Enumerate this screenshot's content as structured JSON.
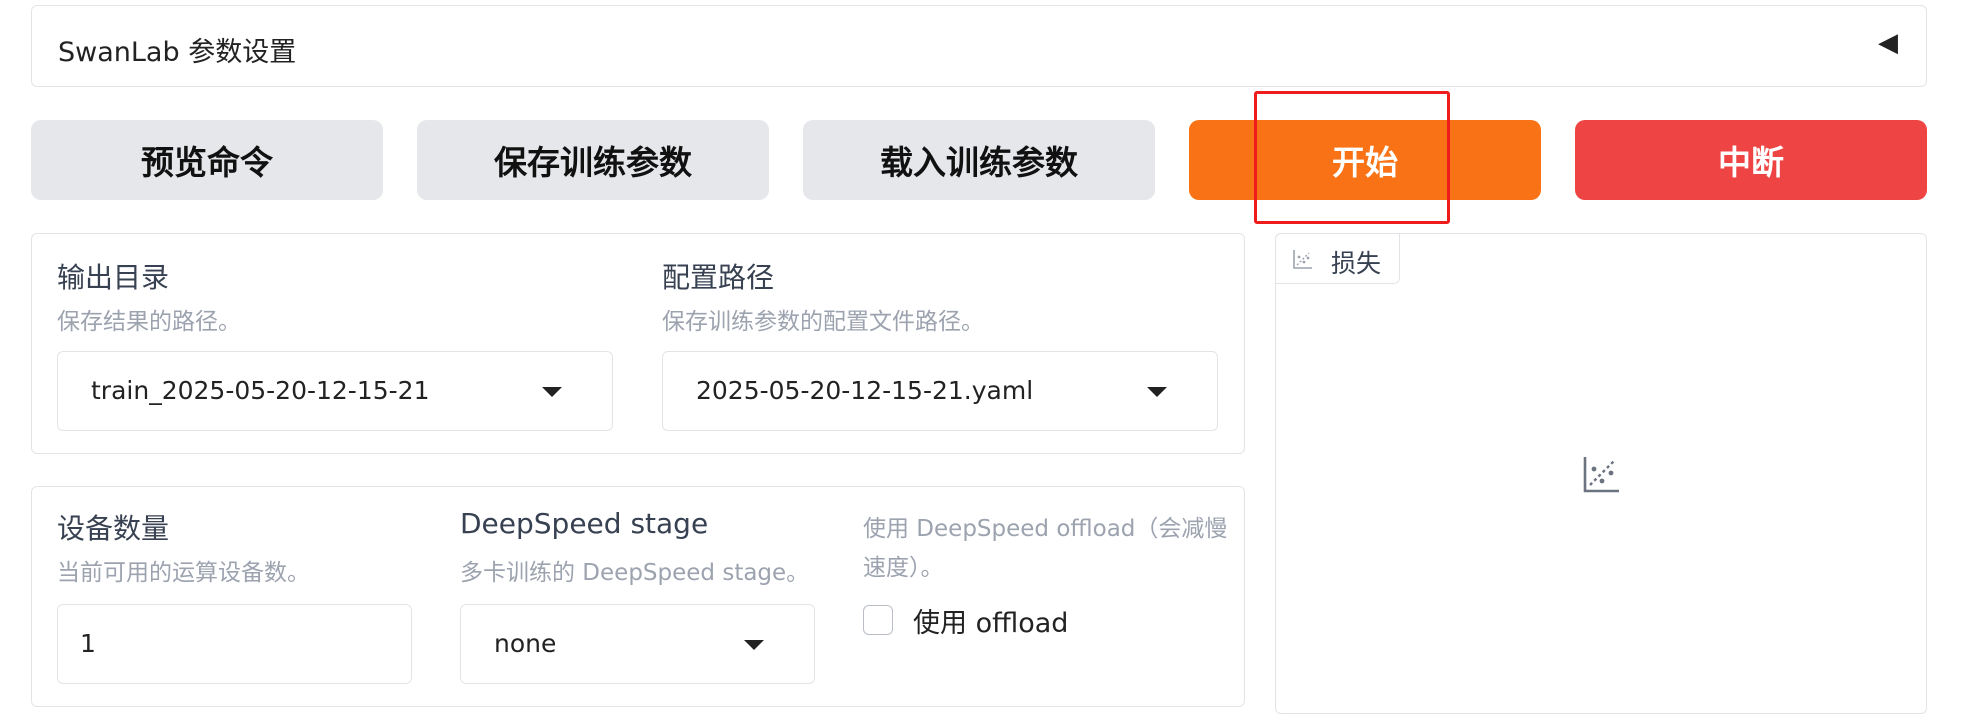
{
  "accordion": {
    "title": "SwanLab 参数设置",
    "arrow": "◀"
  },
  "buttons": {
    "preview": "预览命令",
    "save": "保存训练参数",
    "load": "载入训练参数",
    "start": "开始",
    "abort": "中断"
  },
  "colors": {
    "start": "#f97316",
    "abort": "#ef4444",
    "secondary": "#e5e7eb",
    "highlight": "#ef1c1c"
  },
  "output_dir": {
    "label": "输出目录",
    "info": "保存结果的路径。",
    "value": "train_2025-05-20-12-15-21"
  },
  "config_path": {
    "label": "配置路径",
    "info": "保存训练参数的配置文件路径。",
    "value": "2025-05-20-12-15-21.yaml"
  },
  "device_count": {
    "label": "设备数量",
    "info": "当前可用的运算设备数。",
    "value": "1"
  },
  "ds_stage": {
    "label": "DeepSpeed stage",
    "info": "多卡训练的 DeepSpeed stage。",
    "value": "none"
  },
  "ds_offload": {
    "label_line1": "使用 DeepSpeed offload（会减慢",
    "label_line2": "速度）。",
    "checkbox_label": "使用 offload",
    "checked": false
  },
  "loss_plot": {
    "tab_label": "损失",
    "icon": "chart-icon"
  }
}
